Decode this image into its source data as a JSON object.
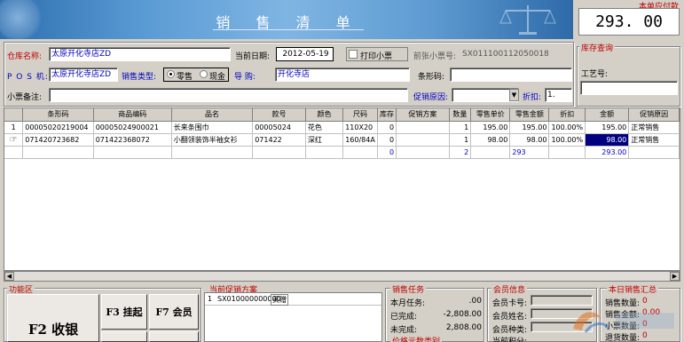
{
  "window": {
    "title": "销 售 清 单",
    "total_label": "本单应付款",
    "total_value": "293. 00"
  },
  "form": {
    "warehouse_label": "仓库名称:",
    "warehouse_value": "太原开化寺店ZD",
    "date_label": "当前日期:",
    "date_value": "2012-05-19",
    "print_label": "打印小票",
    "prev_ticket_label": "前张小票号:",
    "prev_ticket_value": "SX011100112050018",
    "pos_label": "P O S 机:",
    "pos_value": "太原开化寺店ZD",
    "sale_type_label": "销售类型:",
    "sale_type_options": [
      "零售",
      "现金"
    ],
    "guide_label": "导    购:",
    "guide_value": "开化寺店",
    "barcode_label": "条形码:",
    "barcode_value": "",
    "remark_label": "小票备注:",
    "remark_value": "",
    "promo_reason_label": "促销原因:",
    "promo_reason_value": "",
    "discount_label": "折扣:",
    "discount_value": "1."
  },
  "stock_query": {
    "title": "库存查询",
    "craft_label": "工艺号:",
    "craft_value": ""
  },
  "grid": {
    "columns": [
      "",
      "条形码",
      "商品编码",
      "品名",
      "款号",
      "颜色",
      "尺码",
      "库存",
      "促销方案",
      "数量",
      "零售单价",
      "零售金额",
      "折扣",
      "金额",
      "促销原因"
    ],
    "rows": [
      [
        "1",
        "00005020219004",
        "00005024900021",
        "长来条围巾",
        "00005024",
        "花色",
        "110X20",
        "0",
        "",
        "1",
        "195.00",
        "195.00",
        "100.00%",
        "195.00",
        "正常销售"
      ],
      [
        "",
        "071420723682",
        "071422368072",
        "小翻领装饰半袖女衫",
        "071422",
        "深红",
        "160/84A",
        "0",
        "",
        "1",
        "98.00",
        "98.00",
        "100.00%",
        "98.00",
        "正常销售"
      ]
    ],
    "totals": [
      "",
      "",
      "",
      "",
      "",
      "",
      "",
      "0",
      "",
      "2",
      "",
      "293",
      "",
      "293.00",
      ""
    ]
  },
  "bottom": {
    "func_area_title": "功能区",
    "btn_checkout": "F2 收银",
    "btn_hold": "F3 挂起",
    "btn_member": "F7 会员",
    "promo_title": "当前促销方案",
    "promo_rows": [
      [
        "1",
        "SX010000000000",
        "买赠"
      ]
    ],
    "task_title": "销售任务",
    "task_items": [
      {
        "label": "本月任务:",
        "value": ".00"
      },
      {
        "label": "已完成:",
        "value": "-2,808.00"
      },
      {
        "label": "未完成:",
        "value": "2,808.00"
      }
    ],
    "price_title": "价格元数类别",
    "member_title": "会员信息",
    "member_items": [
      "会员卡号:",
      "会员姓名:",
      "会员种类:",
      "当前积分:"
    ],
    "daily_title": "本日销售汇总",
    "daily_items": [
      {
        "label": "销售数量:",
        "value": "0"
      },
      {
        "label": "销售金额:",
        "value": "0.00"
      },
      {
        "label": "小票数量:",
        "value": "0"
      },
      {
        "label": "退货数量:",
        "value": "0"
      }
    ]
  }
}
